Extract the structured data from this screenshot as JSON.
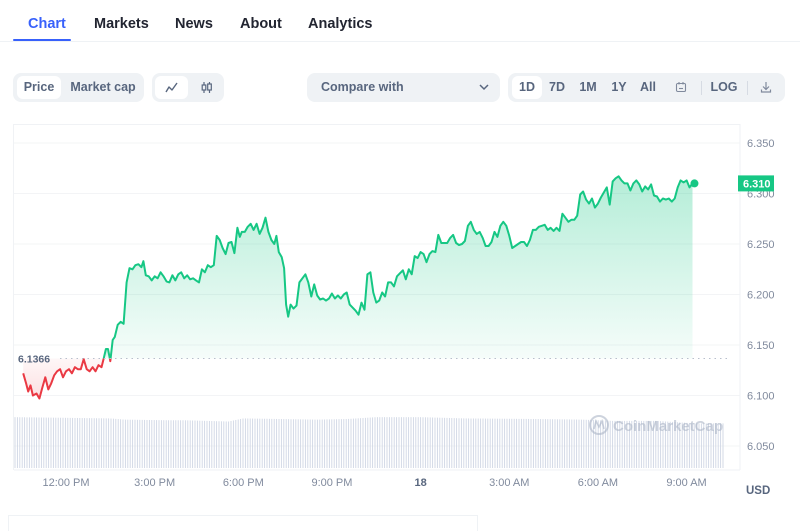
{
  "tabs": [
    {
      "label": "Chart",
      "active": true
    },
    {
      "label": "Markets",
      "active": false
    },
    {
      "label": "News",
      "active": false
    },
    {
      "label": "About",
      "active": false
    },
    {
      "label": "Analytics",
      "active": false
    }
  ],
  "toolbar": {
    "metric_toggle": [
      {
        "label": "Price",
        "selected": true
      },
      {
        "label": "Market cap",
        "selected": false
      }
    ],
    "chart_type_toggle": [
      {
        "icon": "line-chart-icon",
        "selected": true
      },
      {
        "icon": "candlestick-icon",
        "selected": false
      }
    ],
    "compare": {
      "label": "Compare with",
      "icon": "chevron-down-icon"
    },
    "ranges": [
      {
        "label": "1D",
        "selected": true
      },
      {
        "label": "7D",
        "selected": false
      },
      {
        "label": "1M",
        "selected": false
      },
      {
        "label": "1Y",
        "selected": false
      },
      {
        "label": "All",
        "selected": false
      }
    ],
    "calendar_icon": "calendar-icon",
    "log_label": "LOG",
    "download_icon": "download-icon"
  },
  "colors": {
    "accent": "#3861fb",
    "up": "#16c784",
    "down": "#ea3943",
    "axis_text": "#808a9d",
    "volume": "#cfd6e4"
  },
  "watermark": "CoinMarketCap",
  "chart_data": {
    "type": "area",
    "title": "",
    "xlabel": "",
    "ylabel": "USD",
    "currency_label": "USD",
    "ylim": [
      6.03,
      6.37
    ],
    "y_ticks": [
      "6.350",
      "6.300",
      "6.250",
      "6.200",
      "6.150",
      "6.100",
      "6.050"
    ],
    "y_tick_values": [
      6.35,
      6.3,
      6.25,
      6.2,
      6.15,
      6.1,
      6.05
    ],
    "x_ticks": [
      {
        "label": "12:00 PM",
        "h": 0,
        "bold": false
      },
      {
        "label": "3:00 PM",
        "h": 3,
        "bold": false
      },
      {
        "label": "6:00 PM",
        "h": 6,
        "bold": false
      },
      {
        "label": "9:00 PM",
        "h": 9,
        "bold": false
      },
      {
        "label": "18",
        "h": 12,
        "bold": true
      },
      {
        "label": "3:00 AM",
        "h": 15,
        "bold": false
      },
      {
        "label": "6:00 AM",
        "h": 18,
        "bold": false
      },
      {
        "label": "9:00 AM",
        "h": 21,
        "bold": false
      }
    ],
    "xlim_hours": [
      -1.75,
      22.4
    ],
    "reference_price": 6.1366,
    "reference_label": "6.1366",
    "current_price": 6.31,
    "current_label": "6.310",
    "grid": true,
    "series": [
      {
        "name": "Price",
        "points": [
          [
            -1.45,
            6.122
          ],
          [
            -1.35,
            6.112
          ],
          [
            -1.28,
            6.104
          ],
          [
            -1.2,
            6.11
          ],
          [
            -1.12,
            6.1
          ],
          [
            -1.0,
            6.102
          ],
          [
            -0.9,
            6.097
          ],
          [
            -0.8,
            6.108
          ],
          [
            -0.7,
            6.118
          ],
          [
            -0.6,
            6.106
          ],
          [
            -0.5,
            6.112
          ],
          [
            -0.4,
            6.12
          ],
          [
            -0.3,
            6.124
          ],
          [
            -0.2,
            6.126
          ],
          [
            -0.1,
            6.118
          ],
          [
            0.0,
            6.124
          ],
          [
            0.1,
            6.126
          ],
          [
            0.2,
            6.122
          ],
          [
            0.3,
            6.128
          ],
          [
            0.4,
            6.126
          ],
          [
            0.5,
            6.126
          ],
          [
            0.6,
            6.136
          ],
          [
            0.7,
            6.126
          ],
          [
            0.8,
            6.124
          ],
          [
            0.9,
            6.128
          ],
          [
            1.0,
            6.124
          ],
          [
            1.1,
            6.13
          ],
          [
            1.2,
            6.128
          ],
          [
            1.28,
            6.137
          ],
          [
            1.35,
            6.146
          ],
          [
            1.42,
            6.146
          ],
          [
            1.5,
            6.134
          ],
          [
            1.58,
            6.155
          ],
          [
            1.65,
            6.158
          ],
          [
            1.75,
            6.17
          ],
          [
            1.85,
            6.173
          ],
          [
            1.95,
            6.171
          ],
          [
            2.05,
            6.212
          ],
          [
            2.15,
            6.226
          ],
          [
            2.25,
            6.225
          ],
          [
            2.35,
            6.229
          ],
          [
            2.45,
            6.23
          ],
          [
            2.55,
            6.227
          ],
          [
            2.62,
            6.233
          ],
          [
            2.7,
            6.219
          ],
          [
            2.8,
            6.218
          ],
          [
            2.9,
            6.214
          ],
          [
            3.0,
            6.218
          ],
          [
            3.1,
            6.216
          ],
          [
            3.2,
            6.222
          ],
          [
            3.3,
            6.218
          ],
          [
            3.4,
            6.213
          ],
          [
            3.5,
            6.212
          ],
          [
            3.6,
            6.219
          ],
          [
            3.7,
            6.214
          ],
          [
            3.8,
            6.22
          ],
          [
            3.9,
            6.222
          ],
          [
            4.0,
            6.216
          ],
          [
            4.1,
            6.219
          ],
          [
            4.2,
            6.215
          ],
          [
            4.3,
            6.216
          ],
          [
            4.4,
            6.214
          ],
          [
            4.5,
            6.212
          ],
          [
            4.6,
            6.225
          ],
          [
            4.7,
            6.222
          ],
          [
            4.8,
            6.229
          ],
          [
            4.9,
            6.227
          ],
          [
            5.0,
            6.229
          ],
          [
            5.1,
            6.258
          ],
          [
            5.2,
            6.254
          ],
          [
            5.3,
            6.246
          ],
          [
            5.4,
            6.24
          ],
          [
            5.5,
            6.251
          ],
          [
            5.6,
            6.252
          ],
          [
            5.7,
            6.241
          ],
          [
            5.8,
            6.266
          ],
          [
            5.88,
            6.257
          ],
          [
            5.95,
            6.262
          ],
          [
            6.05,
            6.262
          ],
          [
            6.15,
            6.267
          ],
          [
            6.25,
            6.27
          ],
          [
            6.35,
            6.264
          ],
          [
            6.45,
            6.27
          ],
          [
            6.55,
            6.26
          ],
          [
            6.65,
            6.266
          ],
          [
            6.75,
            6.276
          ],
          [
            6.85,
            6.262
          ],
          [
            6.95,
            6.254
          ],
          [
            7.05,
            6.25
          ],
          [
            7.12,
            6.258
          ],
          [
            7.2,
            6.242
          ],
          [
            7.3,
            6.237
          ],
          [
            7.38,
            6.226
          ],
          [
            7.45,
            6.19
          ],
          [
            7.52,
            6.178
          ],
          [
            7.6,
            6.19
          ],
          [
            7.7,
            6.186
          ],
          [
            7.8,
            6.189
          ],
          [
            7.9,
            6.212
          ],
          [
            8.0,
            6.216
          ],
          [
            8.1,
            6.22
          ],
          [
            8.2,
            6.212
          ],
          [
            8.3,
            6.198
          ],
          [
            8.4,
            6.21
          ],
          [
            8.5,
            6.199
          ],
          [
            8.6,
            6.195
          ],
          [
            8.7,
            6.196
          ],
          [
            8.8,
            6.194
          ],
          [
            8.9,
            6.196
          ],
          [
            9.0,
            6.201
          ],
          [
            9.1,
            6.196
          ],
          [
            9.2,
            6.199
          ],
          [
            9.3,
            6.196
          ],
          [
            9.4,
            6.2
          ],
          [
            9.5,
            6.202
          ],
          [
            9.6,
            6.19
          ],
          [
            9.7,
            6.187
          ],
          [
            9.8,
            6.184
          ],
          [
            9.9,
            6.18
          ],
          [
            10.0,
            6.192
          ],
          [
            10.1,
            6.185
          ],
          [
            10.2,
            6.22
          ],
          [
            10.3,
            6.222
          ],
          [
            10.4,
            6.202
          ],
          [
            10.5,
            6.192
          ],
          [
            10.6,
            6.194
          ],
          [
            10.7,
            6.202
          ],
          [
            10.8,
            6.198
          ],
          [
            10.9,
            6.212
          ],
          [
            11.0,
            6.212
          ],
          [
            11.1,
            6.208
          ],
          [
            11.2,
            6.218
          ],
          [
            11.3,
            6.221
          ],
          [
            11.4,
            6.224
          ],
          [
            11.5,
            6.215
          ],
          [
            11.6,
            6.225
          ],
          [
            11.7,
            6.22
          ],
          [
            11.8,
            6.238
          ],
          [
            11.9,
            6.236
          ],
          [
            12.0,
            6.242
          ],
          [
            12.1,
            6.24
          ],
          [
            12.2,
            6.232
          ],
          [
            12.3,
            6.24
          ],
          [
            12.4,
            6.243
          ],
          [
            12.5,
            6.242
          ],
          [
            12.6,
            6.259
          ],
          [
            12.7,
            6.251
          ],
          [
            12.8,
            6.251
          ],
          [
            12.9,
            6.251
          ],
          [
            13.0,
            6.256
          ],
          [
            13.1,
            6.259
          ],
          [
            13.2,
            6.251
          ],
          [
            13.3,
            6.249
          ],
          [
            13.4,
            6.25
          ],
          [
            13.5,
            6.253
          ],
          [
            13.6,
            6.268
          ],
          [
            13.7,
            6.272
          ],
          [
            13.8,
            6.264
          ],
          [
            13.9,
            6.26
          ],
          [
            14.0,
            6.262
          ],
          [
            14.1,
            6.256
          ],
          [
            14.2,
            6.248
          ],
          [
            14.3,
            6.248
          ],
          [
            14.4,
            6.252
          ],
          [
            14.5,
            6.262
          ],
          [
            14.6,
            6.257
          ],
          [
            14.7,
            6.268
          ],
          [
            14.8,
            6.272
          ],
          [
            14.9,
            6.268
          ],
          [
            15.0,
            6.258
          ],
          [
            15.1,
            6.246
          ],
          [
            15.2,
            6.248
          ],
          [
            15.3,
            6.25
          ],
          [
            15.4,
            6.252
          ],
          [
            15.5,
            6.252
          ],
          [
            15.6,
            6.248
          ],
          [
            15.7,
            6.254
          ],
          [
            15.8,
            6.264
          ],
          [
            15.9,
            6.264
          ],
          [
            16.0,
            6.267
          ],
          [
            16.1,
            6.268
          ],
          [
            16.2,
            6.269
          ],
          [
            16.3,
            6.264
          ],
          [
            16.4,
            6.266
          ],
          [
            16.5,
            6.263
          ],
          [
            16.6,
            6.266
          ],
          [
            16.7,
            6.263
          ],
          [
            16.8,
            6.28
          ],
          [
            16.9,
            6.276
          ],
          [
            17.0,
            6.272
          ],
          [
            17.1,
            6.274
          ],
          [
            17.2,
            6.274
          ],
          [
            17.3,
            6.278
          ],
          [
            17.4,
            6.299
          ],
          [
            17.5,
            6.302
          ],
          [
            17.6,
            6.294
          ],
          [
            17.7,
            6.29
          ],
          [
            17.8,
            6.295
          ],
          [
            17.9,
            6.286
          ],
          [
            18.0,
            6.29
          ],
          [
            18.1,
            6.296
          ],
          [
            18.2,
            6.301
          ],
          [
            18.3,
            6.306
          ],
          [
            18.4,
            6.289
          ],
          [
            18.5,
            6.312
          ],
          [
            18.6,
            6.315
          ],
          [
            18.7,
            6.317
          ],
          [
            18.8,
            6.313
          ],
          [
            18.9,
            6.31
          ],
          [
            19.0,
            6.31
          ],
          [
            19.1,
            6.303
          ],
          [
            19.2,
            6.31
          ],
          [
            19.3,
            6.313
          ],
          [
            19.4,
            6.309
          ],
          [
            19.5,
            6.302
          ],
          [
            19.6,
            6.307
          ],
          [
            19.7,
            6.304
          ],
          [
            19.8,
            6.309
          ],
          [
            19.9,
            6.298
          ],
          [
            20.0,
            6.297
          ],
          [
            20.1,
            6.292
          ],
          [
            20.2,
            6.295
          ],
          [
            20.3,
            6.294
          ],
          [
            20.4,
            6.295
          ],
          [
            20.5,
            6.292
          ],
          [
            20.6,
            6.295
          ],
          [
            20.7,
            6.306
          ],
          [
            20.8,
            6.313
          ],
          [
            20.9,
            6.311
          ],
          [
            21.0,
            6.313
          ],
          [
            21.1,
            6.306
          ],
          [
            21.2,
            6.31
          ]
        ]
      },
      {
        "name": "Volume",
        "relative_levels": [
          [
            -1.75,
            0.82
          ],
          [
            1.5,
            0.8
          ],
          [
            2.0,
            0.78
          ],
          [
            3.5,
            0.77
          ],
          [
            4.0,
            0.77
          ],
          [
            5.5,
            0.75
          ],
          [
            6.0,
            0.8
          ],
          [
            8.5,
            0.78
          ],
          [
            9.5,
            0.79
          ],
          [
            10.5,
            0.82
          ],
          [
            12.0,
            0.82
          ],
          [
            13.5,
            0.8
          ],
          [
            16.0,
            0.79
          ],
          [
            17.5,
            0.78
          ],
          [
            18.5,
            0.76
          ],
          [
            20.0,
            0.76
          ],
          [
            21.3,
            0.72
          ]
        ]
      }
    ]
  }
}
